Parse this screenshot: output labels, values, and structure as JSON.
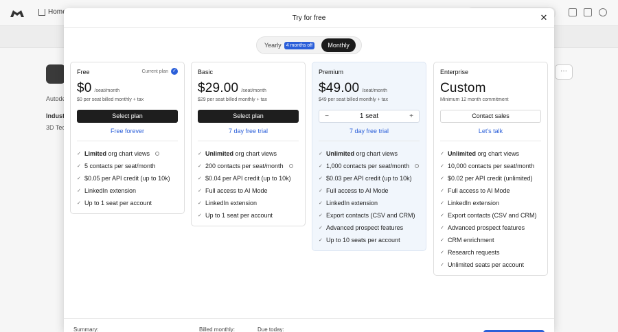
{
  "background": {
    "home_label": "Home",
    "company_partial": "Autode",
    "industry_label": "Indust",
    "industry_value": "3D Tec",
    "more_label": "···"
  },
  "modal": {
    "title": "Try for free",
    "close_label": "✕"
  },
  "billing_toggle": {
    "yearly_label": "Yearly",
    "yearly_badge": "4 months off",
    "monthly_label": "Monthly"
  },
  "plans": [
    {
      "name": "Free",
      "current_plan_label": "Current plan",
      "price": "$0",
      "per": "/seat/month",
      "note": "$0 per seat billed monthly + tax",
      "button": "Select plan",
      "link": "Free forever",
      "features": [
        {
          "bold": "Limited",
          "text": " org chart views",
          "info": true
        },
        {
          "bold": "",
          "text": "5 contacts per seat/month",
          "info": false
        },
        {
          "bold": "",
          "text": "$0.05 per API credit (up to 10k)",
          "info": false
        },
        {
          "bold": "",
          "text": "LinkedIn extension",
          "info": false
        },
        {
          "bold": "",
          "text": "Up to 1 seat per account",
          "info": false
        }
      ]
    },
    {
      "name": "Basic",
      "price": "$29.00",
      "per": "/seat/month",
      "note": "$29 per seat billed monthly + tax",
      "button": "Select plan",
      "link": "7 day free trial",
      "features": [
        {
          "bold": "Unlimited",
          "text": " org chart views",
          "info": false
        },
        {
          "bold": "",
          "text": "200 contacts per seat/month",
          "info": true
        },
        {
          "bold": "",
          "text": "$0.04 per API credit (up to 10k)",
          "info": false
        },
        {
          "bold": "",
          "text": "Full access to AI Mode",
          "info": false
        },
        {
          "bold": "",
          "text": "LinkedIn extension",
          "info": false
        },
        {
          "bold": "",
          "text": "Up to 1 seat per account",
          "info": false
        }
      ]
    },
    {
      "name": "Premium",
      "price": "$49.00",
      "per": "/seat/month",
      "note": "$49 per seat billed monthly + tax",
      "seat_count": "1 seat",
      "minus": "−",
      "plus": "+",
      "link": "7 day free trial",
      "features": [
        {
          "bold": "Unlimited",
          "text": " org chart views",
          "info": false
        },
        {
          "bold": "",
          "text": "1,000 contacts per seat/month",
          "info": true
        },
        {
          "bold": "",
          "text": "$0.03 per API credit (up to 10k)",
          "info": false
        },
        {
          "bold": "",
          "text": "Full access to AI Mode",
          "info": false
        },
        {
          "bold": "",
          "text": "LinkedIn extension",
          "info": false
        },
        {
          "bold": "",
          "text": "Export contacts (CSV and CRM)",
          "info": false
        },
        {
          "bold": "",
          "text": "Advanced prospect features",
          "info": false
        },
        {
          "bold": "",
          "text": "Up to 10 seats per account",
          "info": false
        }
      ]
    },
    {
      "name": "Enterprise",
      "price": "Custom",
      "per": "",
      "note": "Minimum 12 month commitment",
      "button": "Contact sales",
      "link": "Let's talk",
      "features": [
        {
          "bold": "Unlimited",
          "text": " org chart views",
          "info": false
        },
        {
          "bold": "",
          "text": "10,000 contacts per seat/month",
          "info": false
        },
        {
          "bold": "",
          "text": "$0.02 per API credit (unlimited)",
          "info": false
        },
        {
          "bold": "",
          "text": "Full access to AI Mode",
          "info": false
        },
        {
          "bold": "",
          "text": "LinkedIn extension",
          "info": false
        },
        {
          "bold": "",
          "text": "Export contacts (CSV and CRM)",
          "info": false
        },
        {
          "bold": "",
          "text": "Advanced prospect features",
          "info": false
        },
        {
          "bold": "",
          "text": "CRM enrichment",
          "info": false
        },
        {
          "bold": "",
          "text": "Research requests",
          "info": false
        },
        {
          "bold": "",
          "text": "Unlimited seats per account",
          "info": false
        }
      ]
    }
  ],
  "summary": {
    "summary_label": "Summary:",
    "billed_label": "Billed monthly:",
    "due_label": "Due today:"
  },
  "colors": {
    "accent": "#2b5fd9",
    "dark_button": "#1e1e1e",
    "premium_bg": "#f1f6fc"
  }
}
